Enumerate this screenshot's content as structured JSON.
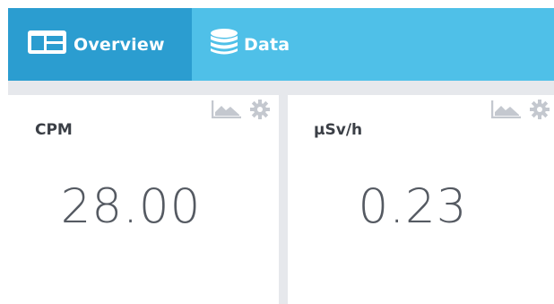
{
  "nav": {
    "tabs": [
      {
        "label": "Overview",
        "icon": "dashboard-layout-icon",
        "active": true
      },
      {
        "label": "Data",
        "icon": "database-icon",
        "active": false
      }
    ]
  },
  "panels": [
    {
      "title": "CPM",
      "value": "28.00",
      "tools": [
        "area-chart-icon",
        "gear-icon"
      ]
    },
    {
      "title": "µSv/h",
      "value": "0.23",
      "tools": [
        "area-chart-icon",
        "gear-icon"
      ]
    }
  ],
  "colors": {
    "navbar": "#4fc0e8",
    "nav_active": "#2b9dd0",
    "background": "#e6e8ec",
    "panel": "#ffffff",
    "icon_muted": "#c4c8cf",
    "title_text": "#3b3f46",
    "value_text": "#555a62"
  }
}
